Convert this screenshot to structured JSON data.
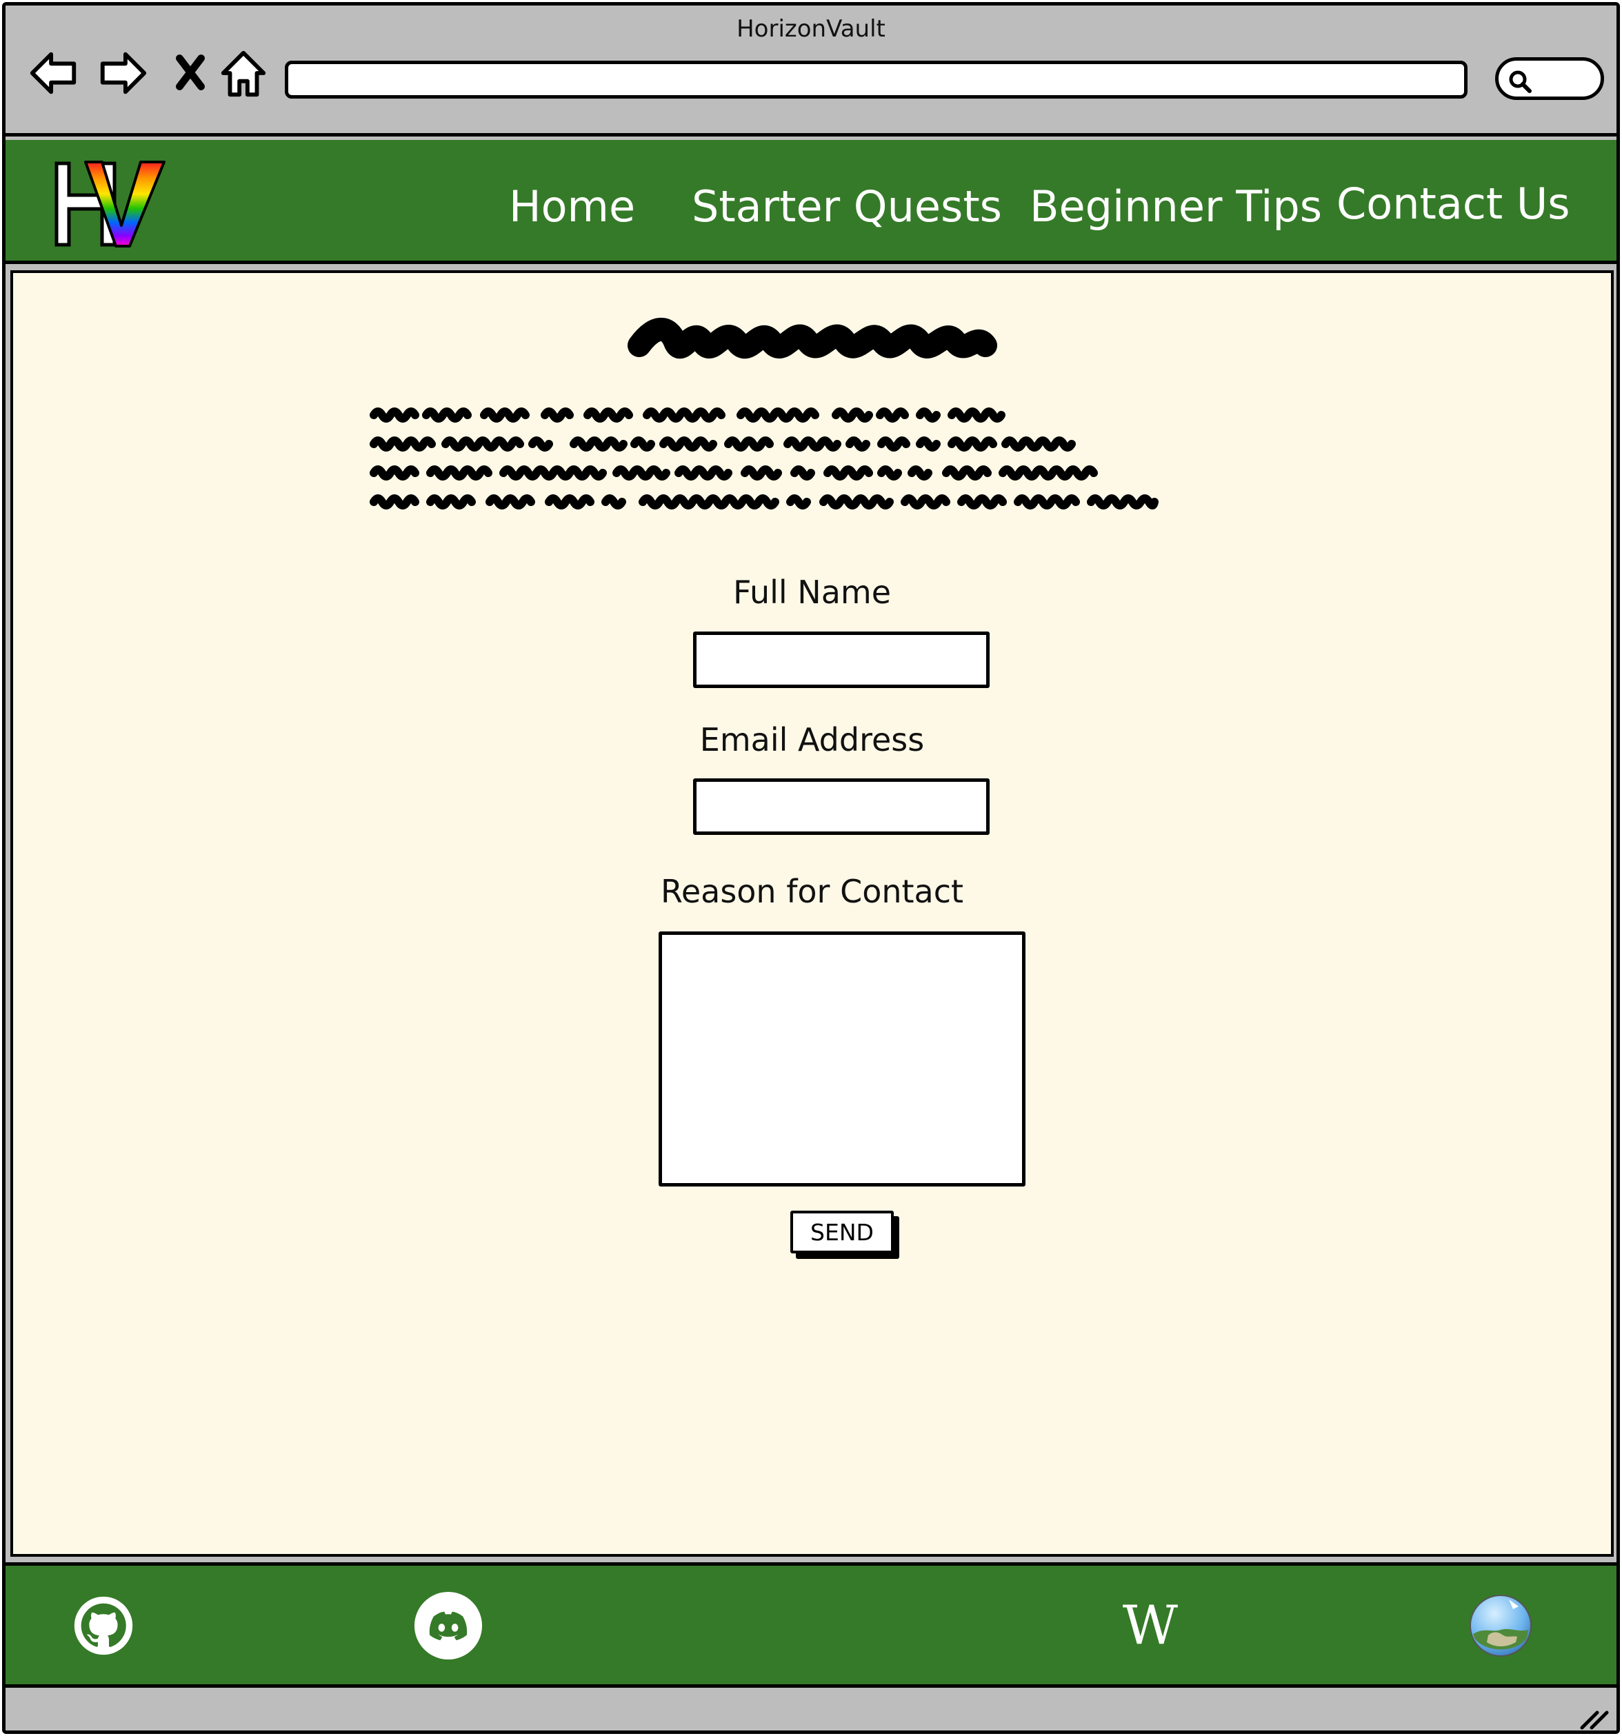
{
  "browser": {
    "window_title": "HorizonVault",
    "address": "",
    "icons": {
      "back": "back-arrow-icon",
      "forward": "forward-arrow-icon",
      "stop": "close-icon",
      "home": "home-icon",
      "search": "search-icon"
    }
  },
  "header": {
    "logo_text": "HV",
    "nav": [
      {
        "label": "Home"
      },
      {
        "label": "Starter Quests"
      },
      {
        "label": "Beginner Tips"
      },
      {
        "label": "Contact Us"
      }
    ]
  },
  "form": {
    "name_label": "Full Name",
    "name_value": "",
    "email_label": "Email Address",
    "email_value": "",
    "reason_label": "Reason for Contact",
    "reason_value": "",
    "submit_label": "SEND"
  },
  "footer": {
    "links": [
      {
        "icon": "github-icon"
      },
      {
        "icon": "discord-icon"
      },
      {
        "icon": "wikipedia-icon",
        "glyph": "W"
      },
      {
        "icon": "globe-icon"
      }
    ]
  },
  "colors": {
    "header_green": "#357a28",
    "content_background": "#fef9e7",
    "chrome_gray": "#bdbdbd"
  }
}
